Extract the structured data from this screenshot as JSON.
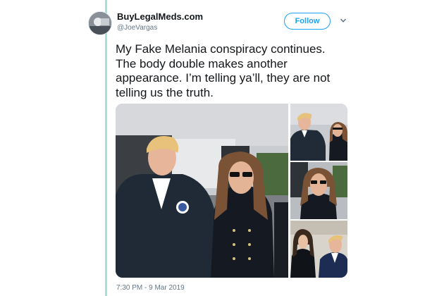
{
  "author": {
    "display_name": "BuyLegalMeds.com",
    "handle": "@JoeVargas",
    "avatar_icon": "avatar-icon"
  },
  "actions": {
    "follow_label": "Follow",
    "menu_icon": "chevron-down-icon"
  },
  "tweet": {
    "text_lines": [
      "My Fake Melania conspiracy continues.",
      "The body double makes another",
      "appearance. I’m telling ya’ll, they are not",
      "telling us the truth."
    ],
    "photo_count": 4,
    "timestamp": "7:30 PM - 9 Mar 2019"
  },
  "colors": {
    "accent": "#1da1f2",
    "thread_rail": "#a4e0dd",
    "text_primary": "#14171a",
    "text_secondary": "#657786"
  }
}
